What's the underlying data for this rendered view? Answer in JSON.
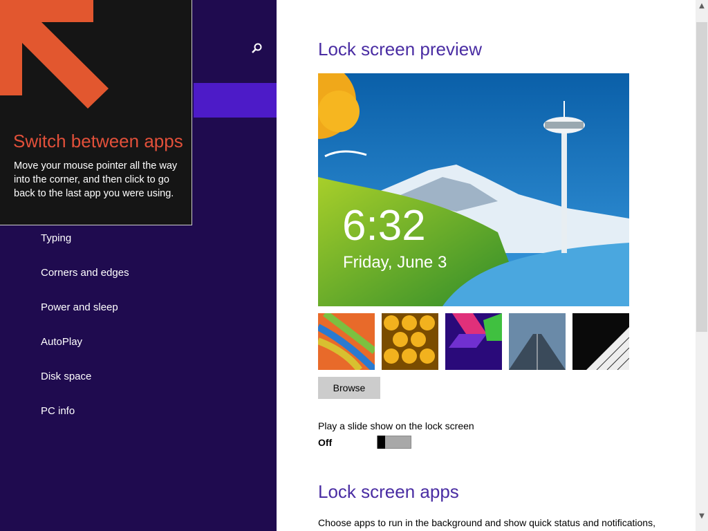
{
  "tip": {
    "title": "Switch between apps",
    "body": "Move your mouse pointer all the way into the corner, and then click to go back to the last app you were using."
  },
  "sidebar": {
    "search_icon": "search-icon",
    "items": [
      {
        "label": "Typing"
      },
      {
        "label": "Corners and edges"
      },
      {
        "label": "Power and sleep"
      },
      {
        "label": "AutoPlay"
      },
      {
        "label": "Disk space"
      },
      {
        "label": "PC info"
      }
    ]
  },
  "main": {
    "preview_title": "Lock screen preview",
    "preview_time": "6:32",
    "preview_date": "Friday, June 3",
    "browse_label": "Browse",
    "slideshow_label": "Play a slide show on the lock screen",
    "slideshow_state": "Off",
    "apps_title": "Lock screen apps",
    "apps_desc": "Choose apps to run in the background and show quick status and notifications,"
  },
  "colors": {
    "sidebar_bg": "#1f0b4f",
    "selected_accent": "#4d1bc8",
    "title_color": "#4a2da3",
    "tip_title": "#e2503a"
  }
}
